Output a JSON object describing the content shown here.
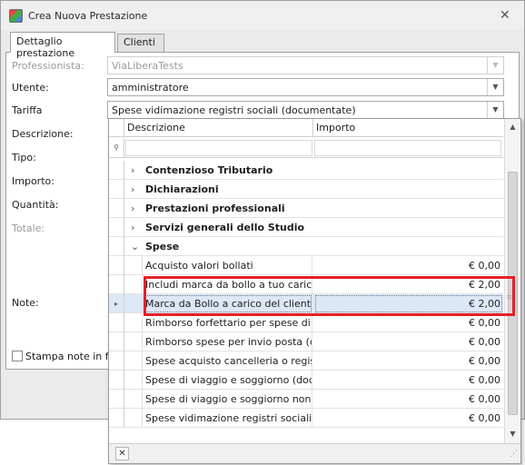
{
  "window": {
    "title": "Crea Nuova Prestazione",
    "close_glyph": "✕"
  },
  "tabs": [
    {
      "label": "Dettaglio prestazione",
      "active": true
    },
    {
      "label": "Clienti",
      "active": false
    }
  ],
  "form": {
    "professionista": {
      "label": "Professionista:",
      "value": "ViaLiberaTests",
      "disabled": true
    },
    "utente": {
      "label": "Utente:",
      "value": "amministratore"
    },
    "tariffa": {
      "label": "Tariffa",
      "value": "Spese vidimazione registri sociali (documentate)"
    },
    "descrizione": {
      "label": "Descrizione:"
    },
    "tipo": {
      "label": "Tipo:"
    },
    "importo": {
      "label": "Importo:"
    },
    "quantita": {
      "label": "Quantità:"
    },
    "totale": {
      "label": "Totale:",
      "disabled": true
    },
    "note": {
      "label": "Note:"
    },
    "stampa_note": {
      "label": "Stampa note in fattura",
      "checked": false
    }
  },
  "dropdown": {
    "columns": {
      "descrizione": "Descrizione",
      "importo": "Importo"
    },
    "filter_icon": "funnel-icon",
    "groups": [
      {
        "label": "Contenzioso Tributario",
        "expanded": false
      },
      {
        "label": "Dichiarazioni",
        "expanded": false
      },
      {
        "label": "Prestazioni professionali",
        "expanded": false
      },
      {
        "label": "Servizi generali dello Studio",
        "expanded": false
      },
      {
        "label": "Spese",
        "expanded": true
      }
    ],
    "rows": [
      {
        "descrizione": "Acquisto valori bollati",
        "importo": "€ 0,00"
      },
      {
        "descrizione": "Includi marca da bollo a tuo carico",
        "importo": "€ 2,00"
      },
      {
        "descrizione": "Marca da Bollo a carico del cliente",
        "importo": "€ 2,00",
        "selected": true
      },
      {
        "descrizione": "Rimborso forfettario per spese di c...",
        "importo": "€ 0,00"
      },
      {
        "descrizione": "Rimborso spese per invio posta (do...",
        "importo": "€ 0,00"
      },
      {
        "descrizione": "Spese acquisto cancelleria o regist...",
        "importo": "€ 0,00"
      },
      {
        "descrizione": "Spese di viaggio e soggiorno (docu...",
        "importo": "€ 0,00"
      },
      {
        "descrizione": "Spese di viaggio e soggiorno non d...",
        "importo": "€ 0,00"
      },
      {
        "descrizione": "Spese vidimazione registri sociali (d...",
        "importo": "€ 0,00"
      }
    ],
    "close_glyph": "✕"
  },
  "colors": {
    "highlight": "#e5202a",
    "selected_row": "#dde8f6"
  }
}
